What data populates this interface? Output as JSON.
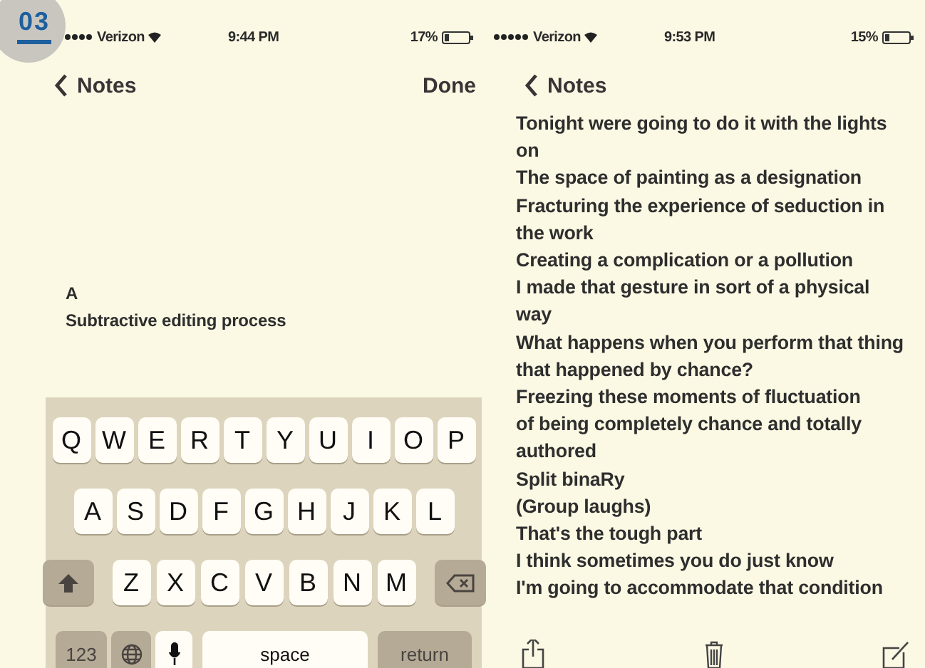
{
  "badge": "03",
  "screens": [
    {
      "status": {
        "carrier": "Verizon",
        "time": "9:44 PM",
        "battery": "17%"
      },
      "nav": {
        "back": "Notes",
        "done": "Done"
      },
      "note_lines": [
        "A",
        "Subtractive editing process"
      ],
      "keyboard": {
        "rows": [
          {
            "keys": [
              {
                "kind": "letter",
                "label": "Q"
              },
              {
                "kind": "letter",
                "label": "W"
              },
              {
                "kind": "letter",
                "label": "E"
              },
              {
                "kind": "letter",
                "label": "R"
              },
              {
                "kind": "letter",
                "label": "T"
              },
              {
                "kind": "letter",
                "label": "Y"
              },
              {
                "kind": "letter",
                "label": "U"
              },
              {
                "kind": "letter",
                "label": "I"
              },
              {
                "kind": "letter",
                "label": "O"
              },
              {
                "kind": "letter",
                "label": "P"
              }
            ]
          },
          {
            "keys": [
              {
                "kind": "letter",
                "label": "A"
              },
              {
                "kind": "letter",
                "label": "S"
              },
              {
                "kind": "letter",
                "label": "D"
              },
              {
                "kind": "letter",
                "label": "F"
              },
              {
                "kind": "letter",
                "label": "G"
              },
              {
                "kind": "letter",
                "label": "H"
              },
              {
                "kind": "letter",
                "label": "J"
              },
              {
                "kind": "letter",
                "label": "K"
              },
              {
                "kind": "letter",
                "label": "L"
              }
            ]
          },
          {
            "keys": [
              {
                "kind": "shift"
              },
              {
                "kind": "letter",
                "label": "Z"
              },
              {
                "kind": "letter",
                "label": "X"
              },
              {
                "kind": "letter",
                "label": "C"
              },
              {
                "kind": "letter",
                "label": "V"
              },
              {
                "kind": "letter",
                "label": "B"
              },
              {
                "kind": "letter",
                "label": "N"
              },
              {
                "kind": "letter",
                "label": "M"
              },
              {
                "kind": "delete"
              }
            ]
          },
          {
            "keys": [
              {
                "kind": "numbers",
                "label": "123"
              },
              {
                "kind": "globe"
              },
              {
                "kind": "mic"
              },
              {
                "kind": "space",
                "label": "space"
              },
              {
                "kind": "return",
                "label": "return"
              }
            ]
          }
        ]
      }
    },
    {
      "status": {
        "carrier": "Verizon",
        "time": "9:53 PM",
        "battery": "15%"
      },
      "nav": {
        "back": "Notes"
      },
      "note_lines": [
        "Tonight were going to do it with the lights on",
        "The space of painting as a designation",
        "Fracturing the experience of seduction in the work",
        "Creating a complication or a pollution",
        "I made that gesture in sort of a physical way",
        "What happens when you perform that thing that happened by chance?",
        "Freezing these moments of fluctuation",
        "of being completely chance and totally authored",
        "Split binaRy",
        "(Group laughs)",
        "That's the tough part",
        "I think sometimes you do just know",
        "I'm going to accommodate that condition"
      ],
      "toolbar": {
        "items": [
          {
            "kind": "share"
          },
          {
            "kind": "trash"
          },
          {
            "kind": "compose"
          }
        ]
      }
    }
  ]
}
